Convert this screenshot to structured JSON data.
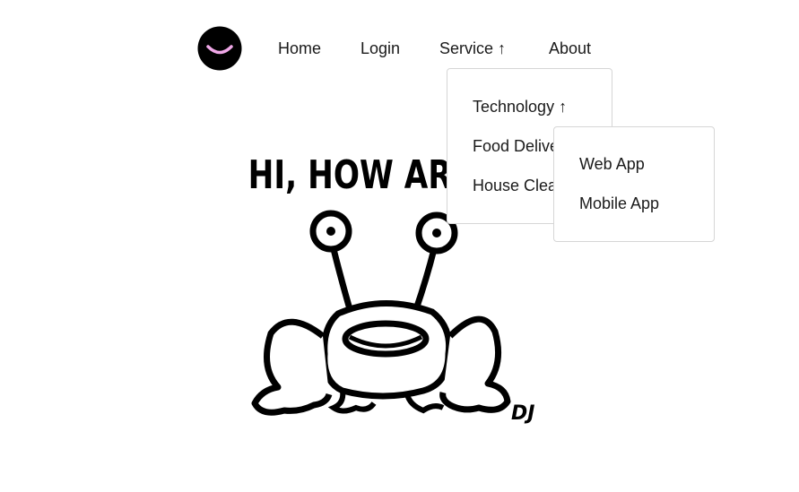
{
  "nav": {
    "logo_icon": "smiley-logo-icon",
    "items": [
      {
        "label": "Home"
      },
      {
        "label": "Login"
      },
      {
        "label": "Service ↑"
      },
      {
        "label": "About"
      }
    ]
  },
  "service_menu": {
    "items": [
      {
        "label": "Technology ↑"
      },
      {
        "label": "Food Delivery"
      },
      {
        "label": "House Cleaning"
      }
    ]
  },
  "technology_menu": {
    "items": [
      {
        "label": "Web App"
      },
      {
        "label": "Mobile App"
      }
    ]
  },
  "hero": {
    "headline": "HI, HOW ARE YOU",
    "signature": "DJ"
  },
  "colors": {
    "logo_face": "#000000",
    "logo_smile": "#f0a8e8",
    "border": "#d6d6d6",
    "text": "#1a1a1a"
  }
}
